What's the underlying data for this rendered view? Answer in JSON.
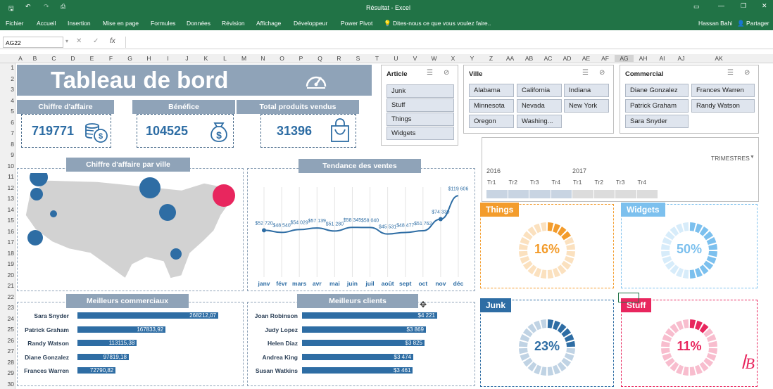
{
  "window": {
    "title": "Résultat - Excel",
    "user": "Hassan Bahi",
    "share_label": "Partager"
  },
  "ribbon": {
    "tabs": [
      "Fichier",
      "Accueil",
      "Insertion",
      "Mise en page",
      "Formules",
      "Données",
      "Révision",
      "Affichage",
      "Développeur",
      "Power Pivot"
    ],
    "tell_me": "Dites-nous ce que vous voulez faire.."
  },
  "formula": {
    "namebox": "AG22",
    "fx": "fx",
    "value": ""
  },
  "columns": [
    "A",
    "B",
    "C",
    "D",
    "E",
    "F",
    "G",
    "H",
    "I",
    "J",
    "K",
    "L",
    "M",
    "N",
    "O",
    "P",
    "Q",
    "R",
    "S",
    "T",
    "U",
    "V",
    "W",
    "X",
    "Y",
    "Z",
    "AA",
    "AB",
    "AC",
    "AD",
    "AE",
    "AF",
    "AG",
    "AH",
    "AI",
    "AJ",
    "AK"
  ],
  "rows": [
    "1",
    "2",
    "3",
    "4",
    "5",
    "6",
    "7",
    "8",
    "9",
    "10",
    "11",
    "12",
    "13",
    "14",
    "15",
    "16",
    "17",
    "18",
    "19",
    "20",
    "21",
    "22",
    "23",
    "24",
    "25",
    "26",
    "27",
    "28",
    "29",
    "30"
  ],
  "dashboard": {
    "title": "Tableau de bord",
    "kpis": [
      {
        "label": "Chiffre d'affaire",
        "value": "719771"
      },
      {
        "label": "Bénéfice",
        "value": "104525"
      },
      {
        "label": "Total produits vendus",
        "value": "31396"
      }
    ],
    "map_title": "Chiffre d'affaire par ville",
    "trend_title": "Tendance des ventes",
    "sellers_title": "Meilleurs commerciaux",
    "clients_title": "Meilleurs clients",
    "trend_data_labels": [
      "$52 720",
      "$48 540",
      "$54 029",
      "$57 139",
      "$51 280",
      "$58 345",
      "$58 040",
      "$45 531",
      "$48 477",
      "$51 762",
      "$74 330",
      "$119 606"
    ],
    "trend_months": [
      "janv",
      "févr",
      "mars",
      "avr",
      "mai",
      "juin",
      "juil",
      "août",
      "sept",
      "oct",
      "nov",
      "déc"
    ],
    "sellers": [
      {
        "name": "Sara Snyder",
        "value": "268212,07",
        "num": 268212.07
      },
      {
        "name": "Patrick Graham",
        "value": "167833,92",
        "num": 167833.92
      },
      {
        "name": "Randy Watson",
        "value": "113115,38",
        "num": 113115.38
      },
      {
        "name": "Diane Gonzalez",
        "value": "97819,18",
        "num": 97819.18
      },
      {
        "name": "Frances Warren",
        "value": "72790,82",
        "num": 72790.82
      }
    ],
    "clients": [
      {
        "name": "Joan Robinson",
        "value": "$4 221",
        "num": 4221
      },
      {
        "name": "Judy Lopez",
        "value": "$3 869",
        "num": 3869
      },
      {
        "name": "Helen Diaz",
        "value": "$3 825",
        "num": 3825
      },
      {
        "name": "Andrea King",
        "value": "$3 474",
        "num": 3474
      },
      {
        "name": "Susan Watkins",
        "value": "$3 461",
        "num": 3461
      }
    ],
    "slicers": {
      "article": {
        "title": "Article",
        "items": [
          "Junk",
          "Stuff",
          "Things",
          "Widgets"
        ]
      },
      "ville": {
        "title": "Ville",
        "items": [
          "Alabama",
          "California",
          "Indiana",
          "Minnesota",
          "Nevada",
          "New York",
          "Oregon",
          "Washing..."
        ]
      },
      "commercial": {
        "title": "Commercial",
        "items": [
          "Diane Gonzalez",
          "Frances Warren",
          "Patrick Graham",
          "Randy Watson",
          "Sara Snyder"
        ]
      }
    },
    "timeline": {
      "label": "TRIMESTRES",
      "years": [
        "2016",
        "2017"
      ],
      "quarters": [
        "Tr1",
        "Tr2",
        "Tr3",
        "Tr4",
        "Tr1",
        "Tr2",
        "Tr3",
        "Tr4"
      ]
    },
    "products": [
      {
        "label": "Things",
        "pct": "16%",
        "value": 0.16,
        "color": "#f39c2c"
      },
      {
        "label": "Widgets",
        "pct": "50%",
        "value": 0.5,
        "color": "#7cc0ee"
      },
      {
        "label": "Junk",
        "pct": "23%",
        "value": 0.23,
        "color": "#2e6da4"
      },
      {
        "label": "Stuff",
        "pct": "11%",
        "value": 0.11,
        "color": "#e8265e"
      }
    ]
  },
  "chart_data": {
    "type": "line",
    "title": "Tendance des ventes",
    "categories": [
      "janv",
      "févr",
      "mars",
      "avr",
      "mai",
      "juin",
      "juil",
      "août",
      "sept",
      "oct",
      "nov",
      "déc"
    ],
    "values": [
      52720,
      48540,
      54029,
      57139,
      51280,
      58345,
      58040,
      45531,
      48477,
      51762,
      74330,
      119606
    ]
  }
}
